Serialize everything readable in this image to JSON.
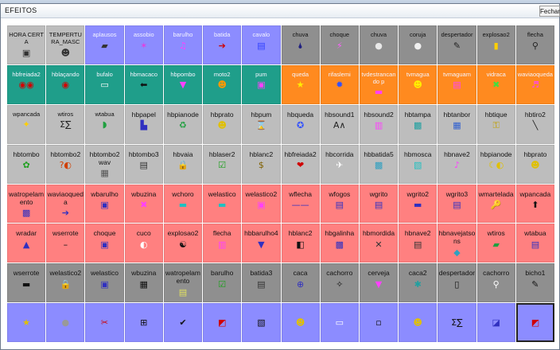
{
  "window": {
    "title": "EFEITOS",
    "close_label": "Fechar"
  },
  "rows": [
    [
      {
        "label": "HORA CERTA",
        "icon": "▣",
        "color": "#333",
        "bg": "gray",
        "big": false
      },
      {
        "label": "TEMPERTURA_MASC",
        "icon": "☻",
        "color": "#333",
        "bg": "gray",
        "big": false
      },
      {
        "label": "aplausos",
        "icon": "▰",
        "color": "#333",
        "bg": "blue",
        "big": false
      },
      {
        "label": "assobio",
        "icon": "✶",
        "color": "#e040e0",
        "bg": "blue",
        "big": false
      },
      {
        "label": "barulho",
        "icon": "♫",
        "color": "#ff40ff",
        "bg": "blue",
        "big": false
      },
      {
        "label": "batida",
        "icon": "➔",
        "color": "#d00000",
        "bg": "blue",
        "big": false
      },
      {
        "label": "cavalo",
        "icon": "▤",
        "color": "#3040ff",
        "bg": "blue",
        "big": false
      },
      {
        "label": "chuva",
        "icon": "🌢",
        "color": "#202080",
        "bg": "dgray",
        "big": false
      },
      {
        "label": "choque",
        "icon": "⚡",
        "color": "#ff60ff",
        "bg": "dgray",
        "big": false
      },
      {
        "label": "chuva",
        "icon": "●",
        "color": "#e8e8e8",
        "bg": "dgray",
        "big": false
      },
      {
        "label": "coruja",
        "icon": "●",
        "color": "#f0f0f0",
        "bg": "dgray",
        "big": false
      },
      {
        "label": "despertador",
        "icon": "✎",
        "color": "#222",
        "bg": "dgray",
        "big": false
      },
      {
        "label": "explosao2",
        "icon": "▮",
        "color": "#ffd000",
        "bg": "dgray",
        "big": false
      },
      {
        "label": "flecha",
        "icon": "⚲",
        "color": "#222",
        "bg": "dgray",
        "big": false
      }
    ],
    [
      {
        "label": "hbfreiada2",
        "icon": "◉◉",
        "color": "#d00000",
        "bg": "green",
        "big": false
      },
      {
        "label": "hblaçando",
        "icon": "◉",
        "color": "#d00000",
        "bg": "green",
        "big": false
      },
      {
        "label": "bufalo",
        "icon": "▭",
        "color": "#ffffff",
        "bg": "green",
        "big": false
      },
      {
        "label": "hbmacaco",
        "icon": "⬅",
        "color": "#111",
        "bg": "green",
        "big": false
      },
      {
        "label": "hbpombo",
        "icon": "▼",
        "color": "#ff40ff",
        "bg": "green",
        "big": false
      },
      {
        "label": "moto2",
        "icon": "☻",
        "color": "#ff9900",
        "bg": "green",
        "big": false
      },
      {
        "label": "pum",
        "icon": "▣",
        "color": "#ff40ff",
        "bg": "green",
        "big": false
      },
      {
        "label": "queda",
        "icon": "★",
        "color": "#ffee00",
        "bg": "orange",
        "big": false
      },
      {
        "label": "rifaslemi",
        "icon": "✹",
        "color": "#3050ff",
        "bg": "orange",
        "big": false
      },
      {
        "label": "tvdestrancando p",
        "icon": "▬",
        "color": "#ff40ff",
        "bg": "orange",
        "big": false
      },
      {
        "label": "tvmagua",
        "icon": "☻",
        "color": "#ffee00",
        "bg": "orange",
        "big": false
      },
      {
        "label": "tvmaguam",
        "icon": "▤",
        "color": "#ff40ff",
        "bg": "orange",
        "big": false
      },
      {
        "label": "vidraca",
        "icon": "✖",
        "color": "#40e040",
        "bg": "orange",
        "big": false
      },
      {
        "label": "waviaoqueda",
        "icon": "♬",
        "color": "#ff40ff",
        "bg": "orange",
        "big": false
      }
    ],
    [
      {
        "label": "wpancada",
        "icon": "✦",
        "color": "#ffd000",
        "bg": "gray",
        "big": false
      },
      {
        "label": "wtiros",
        "icon": "Σ∑",
        "color": "#222",
        "bg": "gray",
        "big": false
      },
      {
        "label": "wtabua",
        "icon": "◗",
        "color": "#20a040",
        "bg": "gray",
        "big": false
      },
      {
        "label": "hbpapel",
        "icon": "▙",
        "color": "#3030c0",
        "bg": "gray",
        "big": true
      },
      {
        "label": "hbpianode",
        "icon": "♻",
        "color": "#20a040",
        "bg": "gray",
        "big": true
      },
      {
        "label": "hbprato",
        "icon": "☻",
        "color": "#e0c000",
        "bg": "gray",
        "big": true
      },
      {
        "label": "hbpum",
        "icon": "⌛",
        "color": "#333",
        "bg": "gray",
        "big": true
      },
      {
        "label": "hbqueda",
        "icon": "✪",
        "color": "#3050ff",
        "bg": "gray",
        "big": true
      },
      {
        "label": "hbsound1",
        "icon": "A∧",
        "color": "#222",
        "bg": "gray",
        "big": true
      },
      {
        "label": "hbsound2",
        "icon": "▥",
        "color": "#ff40ff",
        "bg": "gray",
        "big": true
      },
      {
        "label": "hbtampa",
        "icon": "▩",
        "color": "#20a0a0",
        "bg": "gray",
        "big": true
      },
      {
        "label": "hbtanbor",
        "icon": "▦",
        "color": "#3060d0",
        "bg": "gray",
        "big": true
      },
      {
        "label": "hbtique",
        "icon": "⚿",
        "color": "#c0a000",
        "bg": "gray",
        "big": true
      },
      {
        "label": "hbtiro2",
        "icon": "╲",
        "color": "#222",
        "bg": "gray",
        "big": true
      }
    ],
    [
      {
        "label": "hbtombo",
        "icon": "✿",
        "color": "#20a020",
        "bg": "gray",
        "big": true
      },
      {
        "label": "hbtombo2",
        "icon": "?◐",
        "color": "#d04000",
        "bg": "gray",
        "big": true
      },
      {
        "label": "hbtombo2 wav",
        "icon": "▦",
        "color": "#555",
        "bg": "gray",
        "big": true
      },
      {
        "label": "hbtombo3",
        "icon": "▤",
        "color": "#333",
        "bg": "gray",
        "big": true
      },
      {
        "label": "hbvaia",
        "icon": "🔒",
        "color": "#c0a000",
        "bg": "gray",
        "big": true
      },
      {
        "label": "hblaser2",
        "icon": "☑",
        "color": "#20a020",
        "bg": "gray",
        "big": true
      },
      {
        "label": "hblanc2",
        "icon": "$",
        "color": "#806000",
        "bg": "gray",
        "big": true
      },
      {
        "label": "hbfreiada2",
        "icon": "❤",
        "color": "#d00000",
        "bg": "gray",
        "big": true
      },
      {
        "label": "hbcorrida",
        "icon": "✈",
        "color": "#ffffff",
        "bg": "gray",
        "big": true
      },
      {
        "label": "hbbatida5",
        "icon": "▩",
        "color": "#30a0c0",
        "bg": "gray",
        "big": true
      },
      {
        "label": "hbmosca",
        "icon": "▧",
        "color": "#20c0c0",
        "bg": "gray",
        "big": true
      },
      {
        "label": "hbnave2",
        "icon": "♪",
        "color": "#ff40ff",
        "bg": "gray",
        "big": true
      },
      {
        "label": "hbpianode",
        "icon": "☾◐",
        "color": "#e0c000",
        "bg": "gray",
        "big": true
      },
      {
        "label": "hbprato",
        "icon": "☻",
        "color": "#e0c000",
        "bg": "gray",
        "big": true
      }
    ],
    [
      {
        "label": "watropelamento",
        "icon": "▩",
        "color": "#3030c0",
        "bg": "pink",
        "big": true
      },
      {
        "label": "waviaoqueda",
        "icon": "➔",
        "color": "#3030c0",
        "bg": "pink",
        "big": true
      },
      {
        "label": "wbarulho",
        "icon": "▣",
        "color": "#3030c0",
        "bg": "pink",
        "big": true
      },
      {
        "label": "wbuzina",
        "icon": "✖",
        "color": "#ff40ff",
        "bg": "pink",
        "big": true
      },
      {
        "label": "wchoro",
        "icon": "▬",
        "color": "#20c0c0",
        "bg": "pink",
        "big": true
      },
      {
        "label": "welastico",
        "icon": "▬",
        "color": "#20c0c0",
        "bg": "pink",
        "big": true
      },
      {
        "label": "welastico2",
        "icon": "▣",
        "color": "#ff40ff",
        "bg": "pink",
        "big": true
      },
      {
        "label": "wflecha",
        "icon": "——",
        "color": "#3030c0",
        "bg": "pink",
        "big": true
      },
      {
        "label": "wfogos",
        "icon": "▤",
        "color": "#3030c0",
        "bg": "pink",
        "big": true
      },
      {
        "label": "wgrito",
        "icon": "▤",
        "color": "#3030c0",
        "bg": "pink",
        "big": true
      },
      {
        "label": "wgrito2",
        "icon": "▬",
        "color": "#3030c0",
        "bg": "pink",
        "big": true
      },
      {
        "label": "wgrito3",
        "icon": "▤",
        "color": "#3030c0",
        "bg": "pink",
        "big": true
      },
      {
        "label": "wmartelada",
        "icon": "🔑",
        "color": "#c0a000",
        "bg": "pink",
        "big": true
      },
      {
        "label": "wpancada",
        "icon": "⬆",
        "color": "#111",
        "bg": "pink",
        "big": true
      }
    ],
    [
      {
        "label": "wradar",
        "icon": "▲",
        "color": "#3030c0",
        "bg": "pink",
        "big": true
      },
      {
        "label": "wserrote",
        "icon": "–",
        "color": "#111",
        "bg": "pink",
        "big": true
      },
      {
        "label": "choque",
        "icon": "▣",
        "color": "#3030c0",
        "bg": "pink",
        "big": true
      },
      {
        "label": "cuco",
        "icon": "◐",
        "color": "#ffffff",
        "bg": "pink",
        "big": true
      },
      {
        "label": "explosao2",
        "icon": "☯",
        "color": "#111",
        "bg": "pink",
        "big": true
      },
      {
        "label": "flecha",
        "icon": "▥",
        "color": "#ff40ff",
        "bg": "pink",
        "big": true
      },
      {
        "label": "hbbarulho4",
        "icon": "▼",
        "color": "#3030c0",
        "bg": "pink",
        "big": true
      },
      {
        "label": "hblanc2",
        "icon": "◧",
        "color": "#111",
        "bg": "pink",
        "big": true
      },
      {
        "label": "hbgalinha",
        "icon": "▩",
        "color": "#3030c0",
        "bg": "pink",
        "big": true
      },
      {
        "label": "hbmordida",
        "icon": "✕",
        "color": "#333",
        "bg": "pink",
        "big": true
      },
      {
        "label": "hbnave2",
        "icon": "▤",
        "color": "#333",
        "bg": "pink",
        "big": true
      },
      {
        "label": "hbnavejatsons",
        "icon": "◆",
        "color": "#30a0c0",
        "bg": "pink",
        "big": true
      },
      {
        "label": "wtiros",
        "icon": "▰",
        "color": "#20a040",
        "bg": "pink",
        "big": true
      },
      {
        "label": "wtabua",
        "icon": "▤",
        "color": "#3030c0",
        "bg": "pink",
        "big": true
      }
    ],
    [
      {
        "label": "wserrote",
        "icon": "▬",
        "color": "#111",
        "bg": "dgray",
        "big": true
      },
      {
        "label": "welastico2",
        "icon": "🔒",
        "color": "#e0c000",
        "bg": "dgray",
        "big": true
      },
      {
        "label": "welastico",
        "icon": "▣",
        "color": "#3030c0",
        "bg": "dgray",
        "big": true
      },
      {
        "label": "wbuzina",
        "icon": "▦",
        "color": "#111",
        "bg": "dgray",
        "big": true
      },
      {
        "label": "watropelamento",
        "icon": "▤",
        "color": "#e0e060",
        "bg": "dgray",
        "big": true
      },
      {
        "label": "barulho",
        "icon": "☑",
        "color": "#20a020",
        "bg": "dgray",
        "big": true
      },
      {
        "label": "batida3",
        "icon": "▤",
        "color": "#333",
        "bg": "dgray",
        "big": true
      },
      {
        "label": "caca",
        "icon": "⊕",
        "color": "#3030c0",
        "bg": "dgray",
        "big": true
      },
      {
        "label": "cachorro",
        "icon": "✧",
        "color": "#111",
        "bg": "dgray",
        "big": true
      },
      {
        "label": "cerveja",
        "icon": "▼",
        "color": "#ff40ff",
        "bg": "dgray",
        "big": true
      },
      {
        "label": "caca2",
        "icon": "✱",
        "color": "#20a0a0",
        "bg": "dgray",
        "big": true
      },
      {
        "label": "despertador",
        "icon": "▯",
        "color": "#111",
        "bg": "dgray",
        "big": true
      },
      {
        "label": "cachorro",
        "icon": "⚲",
        "color": "#ffffff",
        "bg": "dgray",
        "big": true
      },
      {
        "label": "bicho1",
        "icon": "✎",
        "color": "#111",
        "bg": "dgray",
        "big": true
      }
    ],
    [
      {
        "label": "",
        "icon": "★",
        "color": "#e0c000",
        "bg": "blue",
        "big": false
      },
      {
        "label": "",
        "icon": "●",
        "color": "#999",
        "bg": "blue",
        "big": false
      },
      {
        "label": "",
        "icon": "✂",
        "color": "#d00000",
        "bg": "blue",
        "big": false
      },
      {
        "label": "",
        "icon": "⊞",
        "color": "#111",
        "bg": "blue",
        "big": false
      },
      {
        "label": "",
        "icon": "✔",
        "color": "#111",
        "bg": "blue",
        "big": false
      },
      {
        "label": "",
        "icon": "◩",
        "color": "#d00000",
        "bg": "blue",
        "big": false
      },
      {
        "label": "",
        "icon": "▧",
        "color": "#111",
        "bg": "blue",
        "big": false
      },
      {
        "label": "",
        "icon": "☻",
        "color": "#e0c000",
        "bg": "blue",
        "big": false
      },
      {
        "label": "",
        "icon": "▭",
        "color": "#ffffff",
        "bg": "blue",
        "big": false
      },
      {
        "label": "",
        "icon": "▫",
        "color": "#111",
        "bg": "blue",
        "big": false
      },
      {
        "label": "",
        "icon": "☻",
        "color": "#e0c000",
        "bg": "blue",
        "big": false
      },
      {
        "label": "",
        "icon": "Σ∑",
        "color": "#111",
        "bg": "blue",
        "big": false
      },
      {
        "label": "",
        "icon": "◪",
        "color": "#3030c0",
        "bg": "blue",
        "big": false
      },
      {
        "label": "",
        "icon": "◩",
        "color": "#d00000",
        "bg": "blue",
        "big": false,
        "selected": true
      }
    ]
  ]
}
